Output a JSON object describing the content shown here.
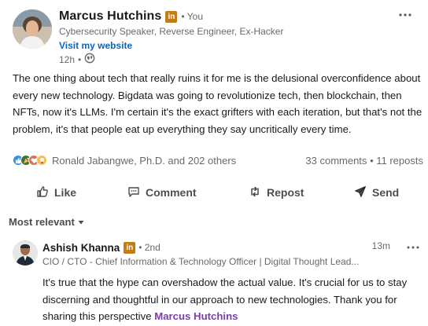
{
  "post": {
    "author": {
      "name": "Marcus Hutchins",
      "badge": "in",
      "you_label": "• You",
      "headline": "Cybersecurity Speaker, Reverse Engineer, Ex-Hacker",
      "website_link": "Visit my website",
      "time": "12h",
      "time_sep": "•",
      "visibility_icon": "globe-icon"
    },
    "more_icon": "more-horizontal-icon",
    "text": "The one thing about tech that really ruins it for me is the delusional overconfidence about every new technology. Bigdata was going to revolutionize tech, then blockchain, then NFTs, now it's LLMs. I'm certain it's the exact grifters with each iteration, but that's not the problem, it's that people eat up everything they say uncritically every time.",
    "social": {
      "reactions": [
        "like",
        "celebrate",
        "love",
        "insightful"
      ],
      "reactors": "Ronald Jabangwe, Ph.D. and 202 others",
      "comments": "33 comments",
      "sep": "•",
      "reposts": "11 reposts"
    },
    "actions": [
      {
        "label": "Like",
        "icon": "thumbs-up-icon"
      },
      {
        "label": "Comment",
        "icon": "comment-icon"
      },
      {
        "label": "Repost",
        "icon": "repost-icon"
      },
      {
        "label": "Send",
        "icon": "send-icon"
      }
    ]
  },
  "sort": {
    "label": "Most relevant",
    "icon": "caret-down-icon"
  },
  "comment": {
    "name": "Ashish Khanna",
    "badge": "in",
    "degree": "• 2nd",
    "headline": "CIO / CTO - Chief Information & Technology Officer | Digital Thought Lead...",
    "time": "13m",
    "text": "It's true that the hype can overshadow the actual value. It's crucial for us to stay discerning and thoughtful in our approach to new technologies. Thank you for sharing this perspective",
    "mention": "Marcus Hutchins"
  },
  "colors": {
    "link": "#0a66c2",
    "badge": "#c37d16",
    "mention": "#7a3ea8",
    "text_secondary": "rgba(0,0,0,0.6)"
  }
}
